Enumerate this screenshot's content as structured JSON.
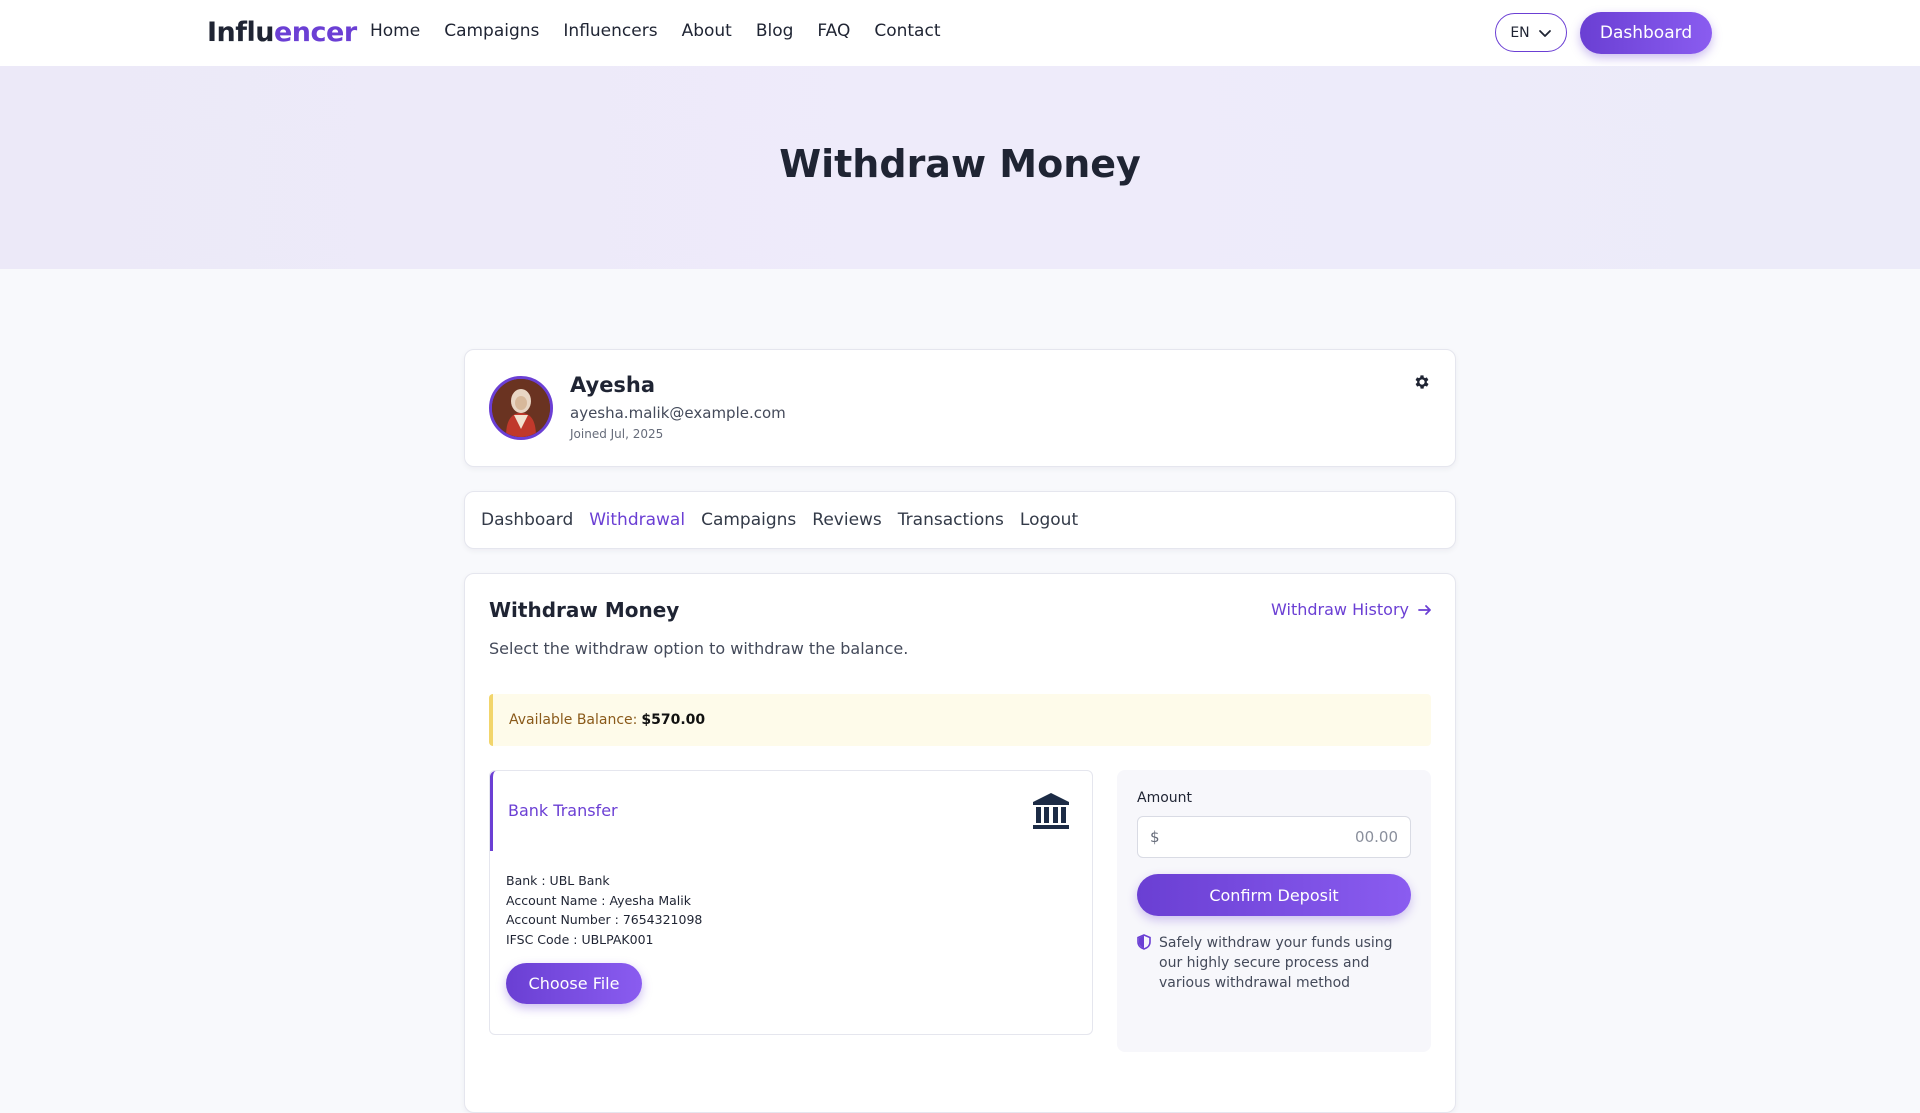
{
  "brand": {
    "part1": "Influ",
    "part2": "encer"
  },
  "nav": {
    "links": [
      "Home",
      "Campaigns",
      "Influencers",
      "About",
      "Blog",
      "FAQ",
      "Contact"
    ]
  },
  "header": {
    "language": "EN",
    "dashboard_label": "Dashboard"
  },
  "hero": {
    "title": "Withdraw Money"
  },
  "profile": {
    "name": "Ayesha",
    "email": "ayesha.malik@example.com",
    "joined": "Joined Jul, 2025"
  },
  "tabs": {
    "items": [
      "Dashboard",
      "Withdrawal",
      "Campaigns",
      "Reviews",
      "Transactions",
      "Logout"
    ],
    "active": "Withdrawal"
  },
  "withdraw": {
    "title": "Withdraw Money",
    "history_link": "Withdraw History",
    "subtitle": "Select the withdraw option to withdraw the balance.",
    "balance_label": "Available Balance:",
    "balance_value": "$570.00"
  },
  "bank": {
    "title": "Bank Transfer",
    "details": [
      "Bank : UBL Bank",
      "Account Name : Ayesha Malik",
      "Account Number : 7654321098",
      "IFSC Code : UBLPAK001"
    ],
    "choose_file": "Choose File"
  },
  "deposit": {
    "amount_label": "Amount",
    "currency": "$",
    "amount_placeholder": "00.00",
    "confirm_label": "Confirm Deposit",
    "secure_note": "Safely withdraw your funds using our highly secure process and various withdrawal method"
  },
  "colors": {
    "accent": "#6b3fd4",
    "balance_bg": "#fefbea",
    "balance_border": "#f2d56b"
  }
}
